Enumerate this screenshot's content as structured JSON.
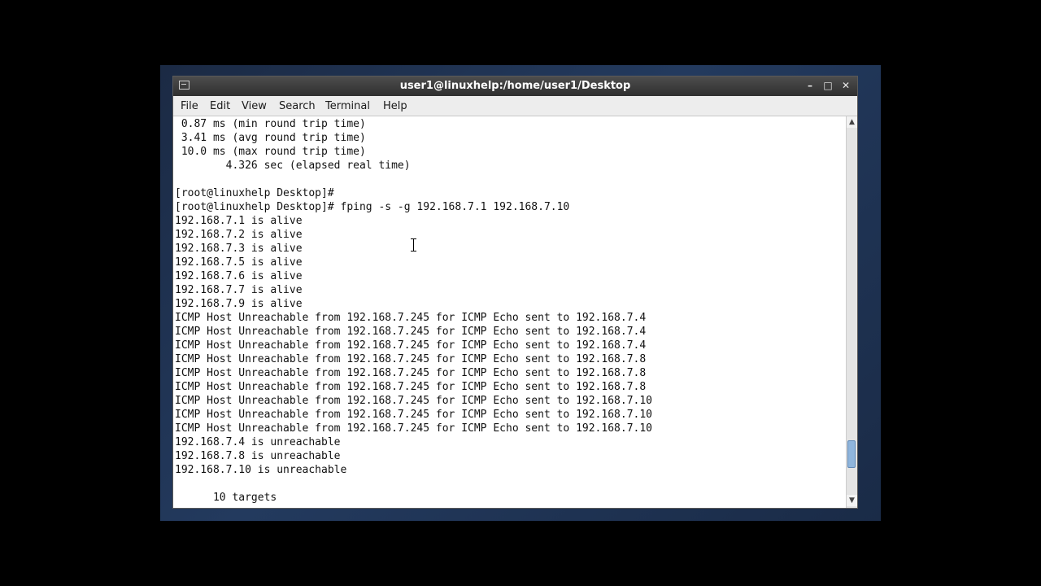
{
  "window": {
    "title": "user1@linuxhelp:/home/user1/Desktop",
    "buttons": {
      "minimize": "–",
      "maximize": "□",
      "close": "✕"
    }
  },
  "menu": [
    "File",
    "Edit",
    "View",
    "Search",
    "Terminal",
    "Help"
  ],
  "terminal": {
    "lines": [
      " 0.87 ms (min round trip time)",
      " 3.41 ms (avg round trip time)",
      " 10.0 ms (max round trip time)",
      "        4.326 sec (elapsed real time)",
      "",
      "[root@linuxhelp Desktop]#",
      "[root@linuxhelp Desktop]# fping -s -g 192.168.7.1 192.168.7.10",
      "192.168.7.1 is alive",
      "192.168.7.2 is alive",
      "192.168.7.3 is alive",
      "192.168.7.5 is alive",
      "192.168.7.6 is alive",
      "192.168.7.7 is alive",
      "192.168.7.9 is alive",
      "ICMP Host Unreachable from 192.168.7.245 for ICMP Echo sent to 192.168.7.4",
      "ICMP Host Unreachable from 192.168.7.245 for ICMP Echo sent to 192.168.7.4",
      "ICMP Host Unreachable from 192.168.7.245 for ICMP Echo sent to 192.168.7.4",
      "ICMP Host Unreachable from 192.168.7.245 for ICMP Echo sent to 192.168.7.8",
      "ICMP Host Unreachable from 192.168.7.245 for ICMP Echo sent to 192.168.7.8",
      "ICMP Host Unreachable from 192.168.7.245 for ICMP Echo sent to 192.168.7.8",
      "ICMP Host Unreachable from 192.168.7.245 for ICMP Echo sent to 192.168.7.10",
      "ICMP Host Unreachable from 192.168.7.245 for ICMP Echo sent to 192.168.7.10",
      "ICMP Host Unreachable from 192.168.7.245 for ICMP Echo sent to 192.168.7.10",
      "192.168.7.4 is unreachable",
      "192.168.7.8 is unreachable",
      "192.168.7.10 is unreachable",
      "",
      "      10 targets"
    ]
  },
  "scrollbar": {
    "up_arrow": "▲",
    "down_arrow": "▼",
    "position": 0.92
  },
  "colors": {
    "titlebar": "#3a3a3a",
    "terminal_bg": "#ffffff",
    "terminal_text": "#111111",
    "scroll_thumb": "#8fb5dc"
  }
}
